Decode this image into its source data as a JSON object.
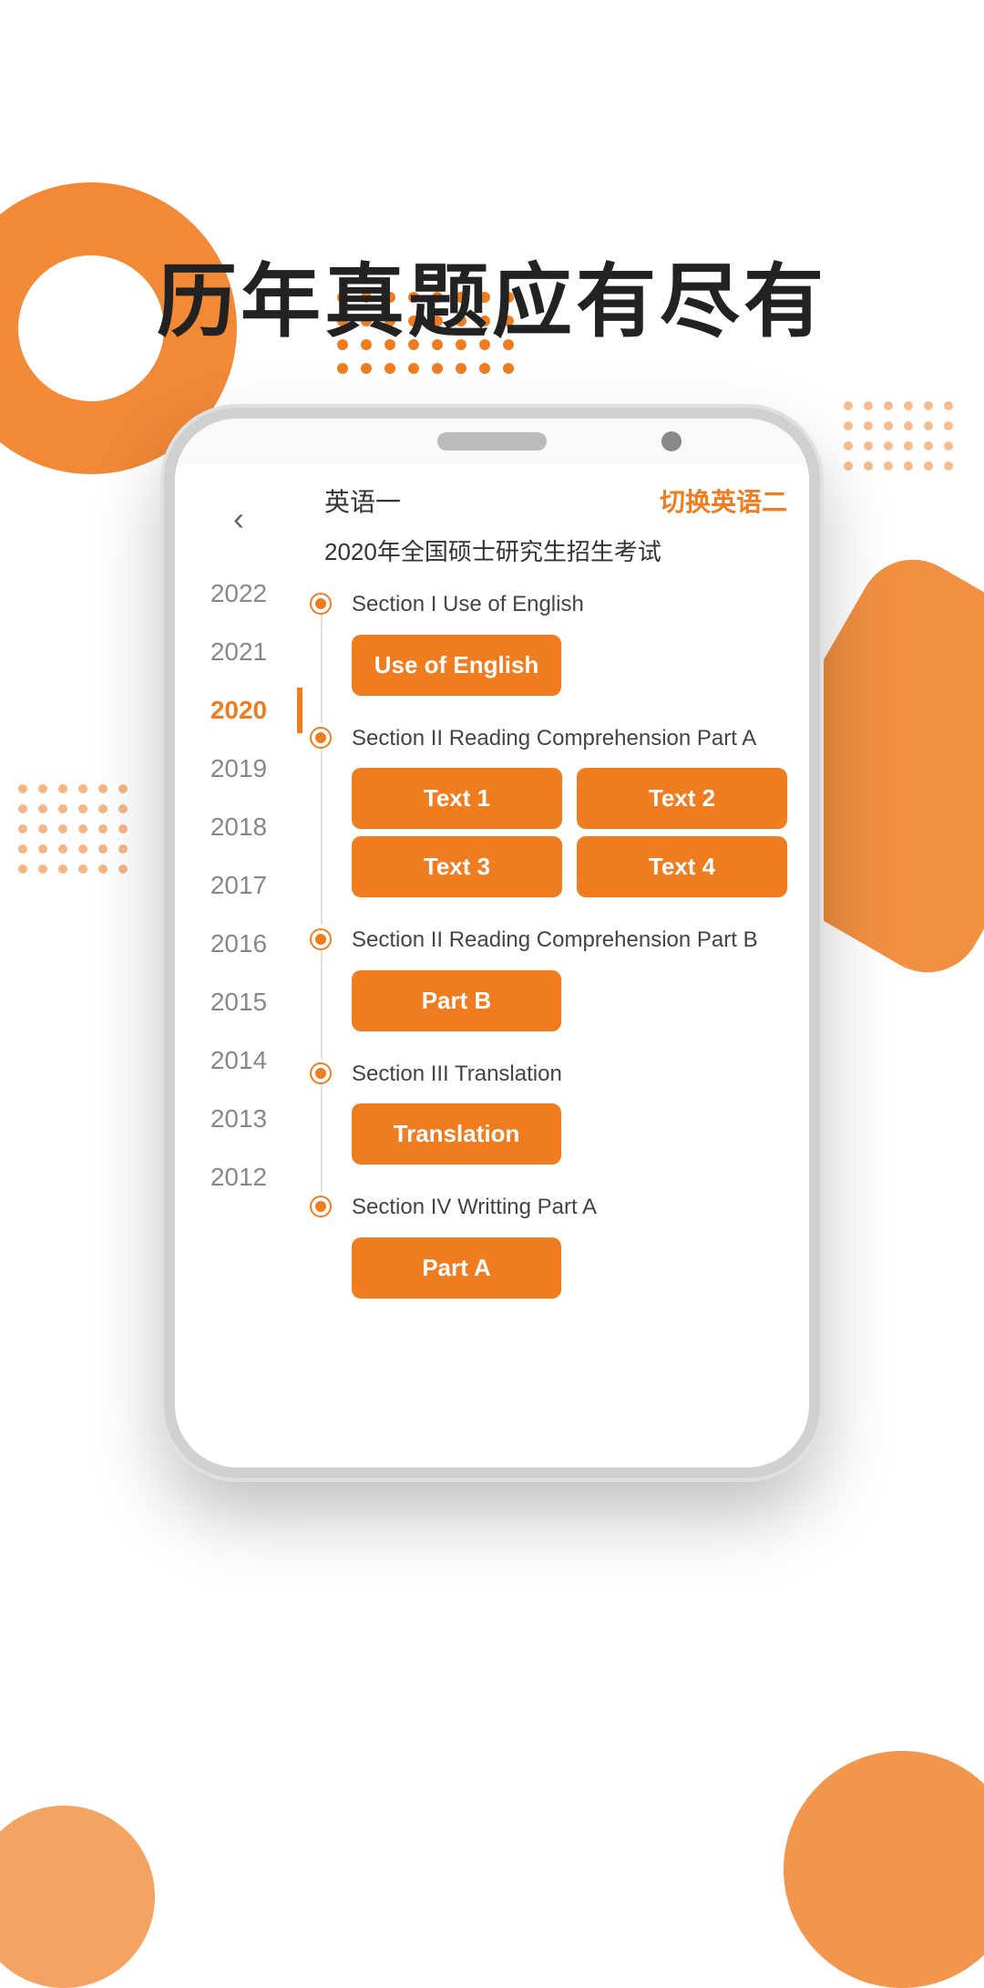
{
  "page": {
    "hero_title": "历年真题应有尽有",
    "accent_color": "#f07c20"
  },
  "phone": {
    "header": {
      "subject": "英语一",
      "switch_label": "切换英语二"
    },
    "exam_title": "2020年全国硕士研究生招生考试",
    "back_icon": "‹",
    "sections": [
      {
        "id": "section1",
        "label": "Section I Use of English",
        "buttons": [
          {
            "label": "Use of English"
          }
        ]
      },
      {
        "id": "section2",
        "label": "Section II Reading Comprehension Part A",
        "buttons": [
          {
            "label": "Text 1"
          },
          {
            "label": "Text 2"
          },
          {
            "label": "Text 3"
          },
          {
            "label": "Text 4"
          }
        ]
      },
      {
        "id": "section3",
        "label": "Section II Reading Comprehension Part B",
        "buttons": [
          {
            "label": "Part B"
          }
        ]
      },
      {
        "id": "section4",
        "label": "Section III Translation",
        "buttons": [
          {
            "label": "Translation"
          }
        ]
      },
      {
        "id": "section5",
        "label": "Section IV Writting Part A",
        "buttons": [
          {
            "label": "Part A"
          }
        ]
      }
    ],
    "years": [
      {
        "label": "2022",
        "active": false
      },
      {
        "label": "2021",
        "active": false
      },
      {
        "label": "2020",
        "active": true
      },
      {
        "label": "2019",
        "active": false
      },
      {
        "label": "2018",
        "active": false
      },
      {
        "label": "2017",
        "active": false
      },
      {
        "label": "2016",
        "active": false
      },
      {
        "label": "2015",
        "active": false
      },
      {
        "label": "2014",
        "active": false
      },
      {
        "label": "2013",
        "active": false
      },
      {
        "label": "2012",
        "active": false
      }
    ]
  },
  "decorative": {
    "dots_top_count": 32,
    "dots_tr_count": 24,
    "dots_ml_count": 30
  }
}
